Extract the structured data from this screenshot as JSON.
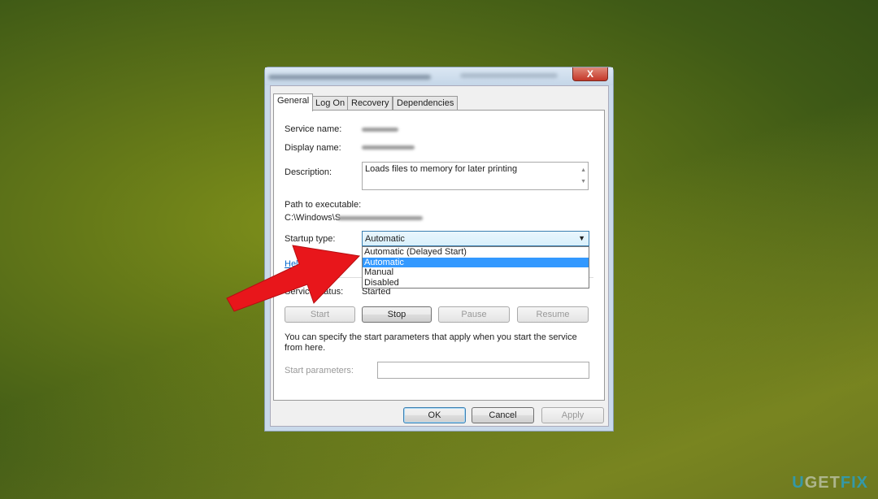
{
  "dialog": {
    "close_label": "X",
    "tabs": [
      "General",
      "Log On",
      "Recovery",
      "Dependencies"
    ],
    "labels": {
      "service_name": "Service name:",
      "display_name": "Display name:",
      "description": "Description:",
      "path": "Path to executable:",
      "startup_type": "Startup type:",
      "help_link": "Help",
      "service_status": "Service status:",
      "start_params": "Start parameters:"
    },
    "description": "Loads files to memory for later printing",
    "path_value": "C:\\Windows\\S",
    "startup": {
      "selected": "Automatic",
      "options": [
        "Automatic (Delayed Start)",
        "Automatic",
        "Manual",
        "Disabled"
      ],
      "highlighted": "Automatic"
    },
    "status_value": "Started",
    "service_buttons": [
      "Start",
      "Stop",
      "Pause",
      "Resume"
    ],
    "note": "You can specify the start parameters that apply when you start the service from here.",
    "footer_buttons": {
      "ok": "OK",
      "cancel": "Cancel",
      "apply": "Apply"
    }
  },
  "watermark": {
    "logo_text": "UGETFIX"
  },
  "colors": {
    "arrow": "#e8161b",
    "highlight": "#3399ff"
  }
}
